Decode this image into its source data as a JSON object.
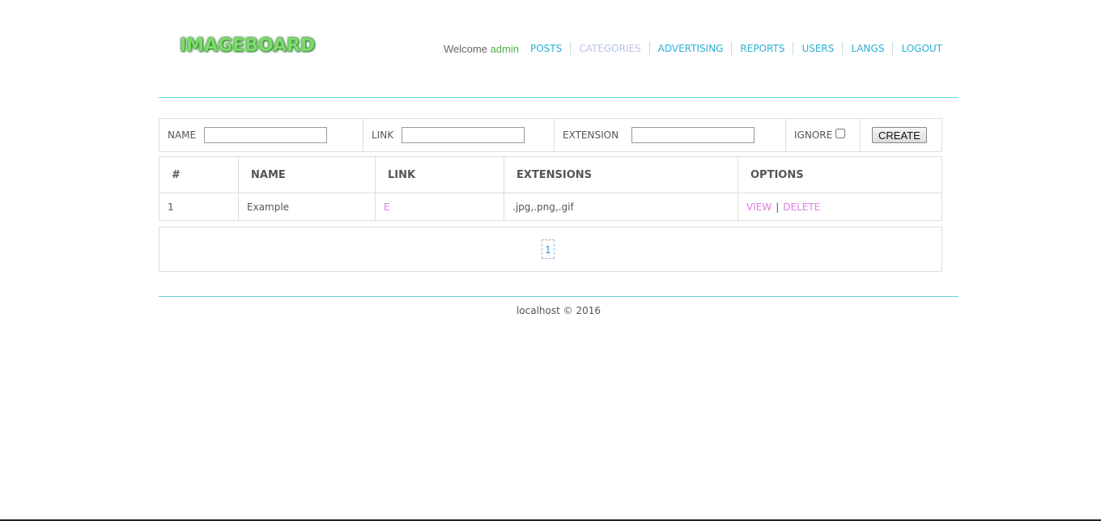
{
  "header": {
    "logo": "IMAGEBOARD",
    "welcome_text": "Welcome",
    "username": "admin",
    "nav": [
      {
        "label": "POSTS"
      },
      {
        "label": "CATEGORIES"
      },
      {
        "label": "ADVERTISING"
      },
      {
        "label": "REPORTS"
      },
      {
        "label": "USERS"
      },
      {
        "label": "LANGS"
      },
      {
        "label": "LOGOUT"
      }
    ]
  },
  "form": {
    "name_label": "NAME",
    "name_value": "",
    "link_label": "LINK",
    "link_value": "",
    "extension_label": "EXTENSION",
    "extension_value": "",
    "ignore_label": "IGNORE",
    "ignore_checked": false,
    "create_label": "CREATE"
  },
  "table": {
    "columns": [
      "#",
      "NAME",
      "LINK",
      "EXTENSIONS",
      "OPTIONS"
    ],
    "rows": [
      {
        "id": "1",
        "name": "Example",
        "link": "E",
        "extensions": ".jpg,.png,.gif",
        "view": "VIEW",
        "sep": "|",
        "delete": "DELETE"
      }
    ]
  },
  "pagination": {
    "current": "1"
  },
  "footer": {
    "text": "localhost © 2016"
  },
  "colors": {
    "accent": "#2ab0d6",
    "active_nav": "#b9c2e8",
    "username": "#55b04a",
    "row_link": "#e07de0",
    "rule": "#5fd6dc"
  }
}
